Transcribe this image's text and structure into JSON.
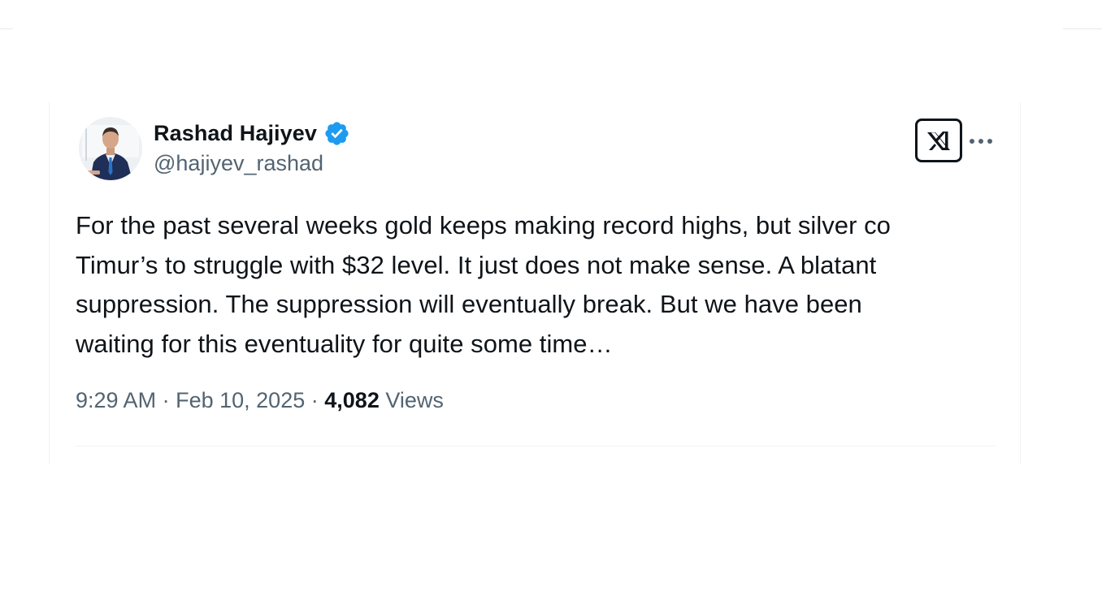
{
  "author": {
    "display_name": "Rashad Hajiyev",
    "handle": "@hajiyev_rashad",
    "verified": true,
    "avatar_icon": "profile-photo",
    "verified_color": "#1d9bf0"
  },
  "tweet": {
    "text": "For the past several weeks gold keeps making record highs, but silver co\nTimur’s to struggle with $32 level. It just does not make sense. A blatant\nsuppression. The suppression will eventually break. But we have been\nwaiting for this eventuality for quite some time…",
    "time": "9:29 AM",
    "separator": "·",
    "date": "Feb 10, 2025",
    "views_count": "4,082",
    "views_label": "Views"
  },
  "toolbar": {
    "logo_icon": "x-logo-icon",
    "more_icon": "more-horizontal-icon"
  },
  "colors": {
    "text_primary": "#0f1419",
    "text_secondary": "#536471",
    "border": "#eff3f4"
  }
}
